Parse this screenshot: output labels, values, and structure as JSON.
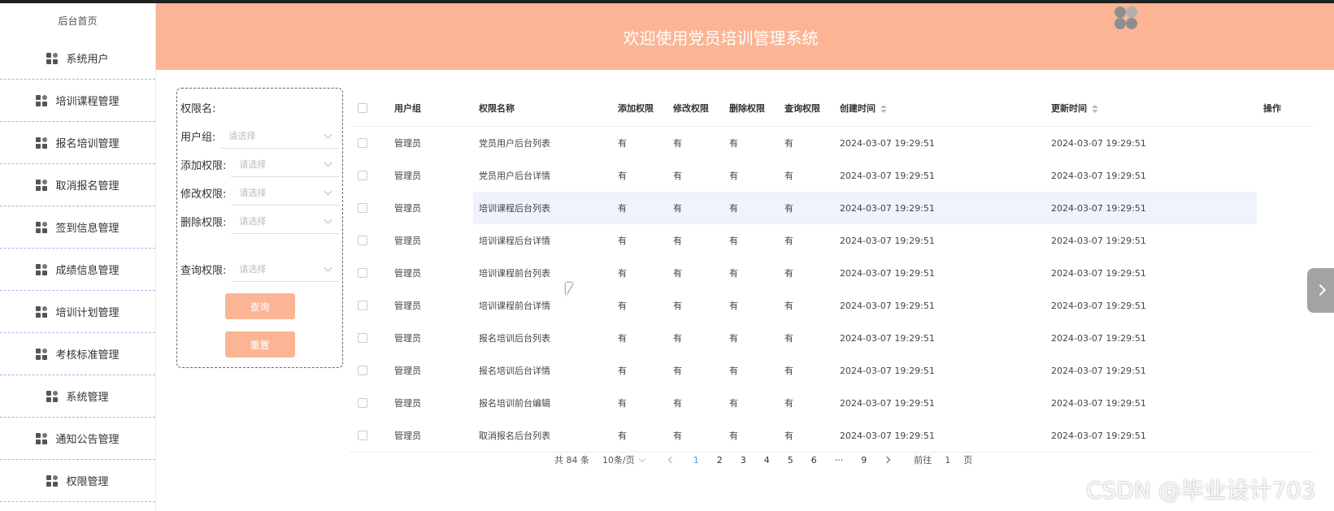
{
  "header": {
    "title": "欢迎使用党员培训管理系统"
  },
  "sidebar": {
    "home": "后台首页",
    "items": [
      {
        "label": "系统用户"
      },
      {
        "label": "培训课程管理"
      },
      {
        "label": "报名培训管理"
      },
      {
        "label": "取消报名管理"
      },
      {
        "label": "签到信息管理"
      },
      {
        "label": "成绩信息管理"
      },
      {
        "label": "培训计划管理"
      },
      {
        "label": "考核标准管理"
      },
      {
        "label": "系统管理"
      },
      {
        "label": "通知公告管理"
      },
      {
        "label": "权限管理"
      }
    ]
  },
  "filter": {
    "name_label": "权限名:",
    "group_label": "用户组:",
    "add_label": "添加权限:",
    "edit_label": "修改权限:",
    "delete_label": "删除权限:",
    "query_label": "查询权限:",
    "placeholder": "请选择",
    "search_button": "查询",
    "reset_button": "重置"
  },
  "table": {
    "headers": [
      "用户组",
      "权限名称",
      "添加权限",
      "修改权限",
      "删除权限",
      "查询权限",
      "创建时间",
      "更新时间",
      "操作"
    ],
    "rows": [
      [
        "管理员",
        "党员用户后台列表",
        "有",
        "有",
        "有",
        "有",
        "2024-03-07 19:29:51",
        "2024-03-07 19:29:51"
      ],
      [
        "管理员",
        "党员用户后台详情",
        "有",
        "有",
        "有",
        "有",
        "2024-03-07 19:29:51",
        "2024-03-07 19:29:51"
      ],
      [
        "管理员",
        "培训课程后台列表",
        "有",
        "有",
        "有",
        "有",
        "2024-03-07 19:29:51",
        "2024-03-07 19:29:51"
      ],
      [
        "管理员",
        "培训课程后台详情",
        "有",
        "有",
        "有",
        "有",
        "2024-03-07 19:29:51",
        "2024-03-07 19:29:51"
      ],
      [
        "管理员",
        "培训课程前台列表",
        "有",
        "有",
        "有",
        "有",
        "2024-03-07 19:29:51",
        "2024-03-07 19:29:51"
      ],
      [
        "管理员",
        "培训课程前台详情",
        "有",
        "有",
        "有",
        "有",
        "2024-03-07 19:29:51",
        "2024-03-07 19:29:51"
      ],
      [
        "管理员",
        "报名培训后台列表",
        "有",
        "有",
        "有",
        "有",
        "2024-03-07 19:29:51",
        "2024-03-07 19:29:51"
      ],
      [
        "管理员",
        "报名培训后台详情",
        "有",
        "有",
        "有",
        "有",
        "2024-03-07 19:29:51",
        "2024-03-07 19:29:51"
      ],
      [
        "管理员",
        "报名培训前台编辑",
        "有",
        "有",
        "有",
        "有",
        "2024-03-07 19:29:51",
        "2024-03-07 19:29:51"
      ],
      [
        "管理员",
        "取消报名后台列表",
        "有",
        "有",
        "有",
        "有",
        "2024-03-07 19:29:51",
        "2024-03-07 19:29:51"
      ]
    ]
  },
  "pager": {
    "total": "共 84 条",
    "size": "10条/页",
    "pages": [
      "1",
      "2",
      "3",
      "4",
      "5",
      "6",
      "···",
      "9"
    ],
    "goto_prefix": "前往",
    "goto_value": "1",
    "goto_suffix": "页"
  },
  "watermark": "CSDN @毕业设计703",
  "colors": {
    "accent": "#fbb594",
    "active_page": "#409eff",
    "highlight_row": "#eef3fc"
  }
}
